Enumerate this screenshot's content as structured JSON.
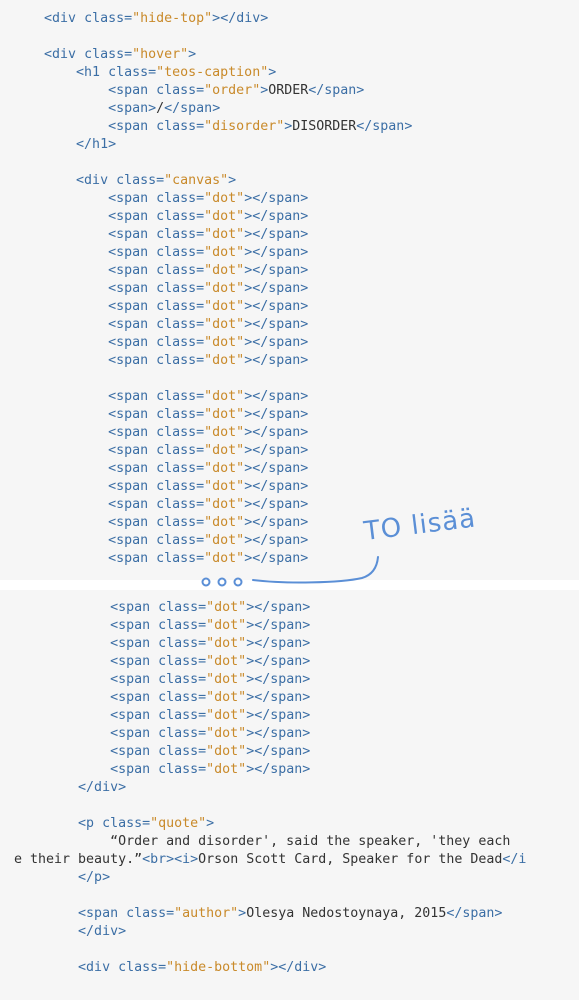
{
  "editor": {
    "accent_colors": {
      "tag": "#3b6ea5",
      "string": "#c98a2a",
      "text": "#333333",
      "annotation": "#5b8fd6"
    },
    "top_lines": [
      {
        "text": "    <div class=\"hide-top\"></div>"
      },
      {
        "text": ""
      },
      {
        "text": "    <div class=\"hover\">"
      },
      {
        "text": "        <h1 class=\"teos-caption\">"
      },
      {
        "text": "            <span class=\"order\">ORDER</span>"
      },
      {
        "text": "            <span>/</span>"
      },
      {
        "text": "            <span class=\"disorder\">DISORDER</span>"
      },
      {
        "text": "        </h1>"
      },
      {
        "text": ""
      },
      {
        "text": "        <div class=\"canvas\">"
      },
      {
        "text": "            <span class=\"dot\"></span>"
      },
      {
        "text": "            <span class=\"dot\"></span>"
      },
      {
        "text": "            <span class=\"dot\"></span>"
      },
      {
        "text": "            <span class=\"dot\"></span>"
      },
      {
        "text": "            <span class=\"dot\"></span>"
      },
      {
        "text": "            <span class=\"dot\"></span>"
      },
      {
        "text": "            <span class=\"dot\"></span>"
      },
      {
        "text": "            <span class=\"dot\"></span>"
      },
      {
        "text": "            <span class=\"dot\"></span>"
      },
      {
        "text": "            <span class=\"dot\"></span>"
      },
      {
        "text": ""
      },
      {
        "text": "            <span class=\"dot\"></span>"
      },
      {
        "text": "            <span class=\"dot\"></span>"
      },
      {
        "text": "            <span class=\"dot\"></span>"
      },
      {
        "text": "            <span class=\"dot\"></span>"
      },
      {
        "text": "            <span class=\"dot\"></span>"
      },
      {
        "text": "            <span class=\"dot\"></span>"
      },
      {
        "text": "            <span class=\"dot\"></span>"
      },
      {
        "text": "            <span class=\"dot\"></span>"
      },
      {
        "text": "            <span class=\"dot\"></span>"
      },
      {
        "text": "            <span class=\"dot\"></span>"
      }
    ],
    "bottom_lines": [
      {
        "text": "            <span class=\"dot\"></span>"
      },
      {
        "text": "            <span class=\"dot\"></span>"
      },
      {
        "text": "            <span class=\"dot\"></span>"
      },
      {
        "text": "            <span class=\"dot\"></span>"
      },
      {
        "text": "            <span class=\"dot\"></span>"
      },
      {
        "text": "            <span class=\"dot\"></span>"
      },
      {
        "text": "            <span class=\"dot\"></span>"
      },
      {
        "text": "            <span class=\"dot\"></span>"
      },
      {
        "text": "            <span class=\"dot\"></span>"
      },
      {
        "text": "            <span class=\"dot\"></span>"
      },
      {
        "text": "        </div>"
      },
      {
        "text": ""
      },
      {
        "text": "        <p class=\"quote\">"
      },
      {
        "text": "            “Order and disorder', said the speaker, 'they each"
      },
      {
        "text": "e their beauty.”<br><i>Orson Scott Card, Speaker for the Dead</i"
      },
      {
        "text": "        </p>"
      },
      {
        "text": ""
      },
      {
        "text": "        <span class=\"author\">Olesya Nedostoynaya, 2015</span>"
      },
      {
        "text": "        </div>"
      },
      {
        "text": ""
      },
      {
        "text": "        <div class=\"hide-bottom\"></div>"
      }
    ]
  },
  "annotation": {
    "handwritten_note": "TO lisää"
  }
}
